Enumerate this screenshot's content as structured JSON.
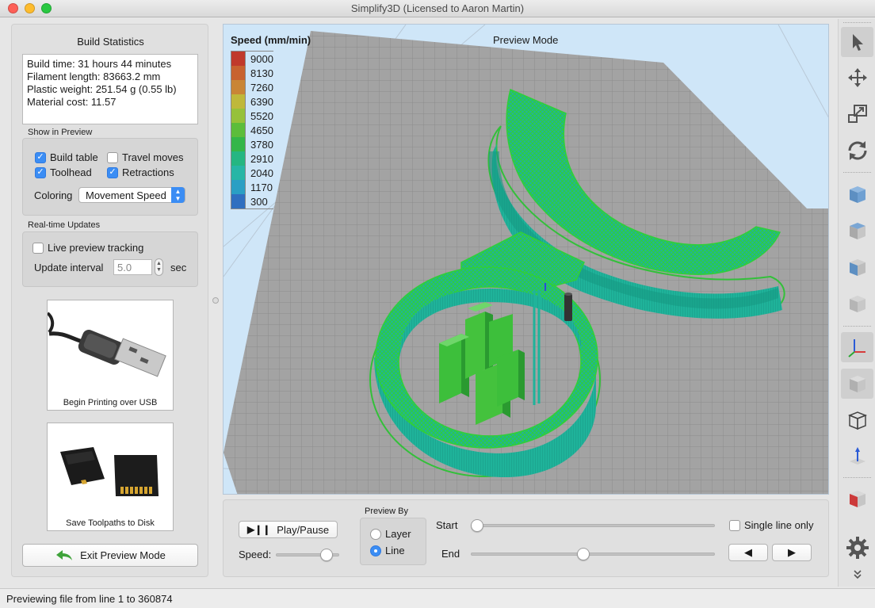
{
  "window": {
    "title": "Simplify3D (Licensed to Aaron Martin)",
    "traffic_lights": [
      "#fd5f57",
      "#febc2e",
      "#29c841"
    ]
  },
  "build_statistics": {
    "title": "Build Statistics",
    "lines": [
      "Build time: 31 hours 44 minutes",
      "Filament length: 83663.2 mm",
      "Plastic weight: 251.54 g (0.55 lb)",
      "Material cost: 11.57"
    ]
  },
  "show_in_preview": {
    "label": "Show in Preview",
    "build_table": {
      "label": "Build table",
      "checked": true
    },
    "travel_moves": {
      "label": "Travel moves",
      "checked": false
    },
    "toolhead": {
      "label": "Toolhead",
      "checked": true
    },
    "retractions": {
      "label": "Retractions",
      "checked": true
    },
    "coloring_label": "Coloring",
    "coloring_value": "Movement Speed"
  },
  "realtime": {
    "label": "Real-time Updates",
    "live_tracking": {
      "label": "Live preview tracking",
      "checked": false
    },
    "interval_label": "Update interval",
    "interval_value": "5.0",
    "interval_unit": "sec"
  },
  "usb_button": {
    "caption": "Begin Printing over USB",
    "icon": "usb-cable-photo"
  },
  "disk_button": {
    "caption": "Save Toolpaths to Disk",
    "icon": "sd-card-photo"
  },
  "exit_button": {
    "label": "Exit Preview Mode",
    "icon": "green-back-arrow-icon"
  },
  "viewport": {
    "mode_title": "Preview Mode",
    "legend_title": "Speed (mm/min)",
    "legend": [
      {
        "value": "9000",
        "color": "#c0392b"
      },
      {
        "value": "8130",
        "color": "#c8622f"
      },
      {
        "value": "7260",
        "color": "#c98535"
      },
      {
        "value": "6390",
        "color": "#bfb83a"
      },
      {
        "value": "5520",
        "color": "#96c13a"
      },
      {
        "value": "4650",
        "color": "#5cbd3b"
      },
      {
        "value": "3780",
        "color": "#34b649"
      },
      {
        "value": "2910",
        "color": "#25b682"
      },
      {
        "value": "2040",
        "color": "#27b6a6"
      },
      {
        "value": "1170",
        "color": "#2a9fc4"
      },
      {
        "value": "300",
        "color": "#2f6fc0"
      }
    ],
    "colors": {
      "background": "#cfe6f8",
      "bed": "#a3a3a3",
      "bed_grid": "#8c8c8c",
      "model": "#1fb39a",
      "model_edge": "#2fcf3a"
    }
  },
  "playback": {
    "play_pause_label": "Play/Pause",
    "speed_label": "Speed:",
    "speed_level": 0.88
  },
  "preview_by": {
    "label": "Preview By",
    "options": [
      {
        "label": "Layer",
        "selected": false
      },
      {
        "label": "Line",
        "selected": true
      }
    ]
  },
  "range": {
    "start_label": "Start",
    "end_label": "End",
    "start_level": 0.0,
    "end_level": 0.46,
    "single_line_label": "Single line only",
    "single_line_checked": false
  },
  "status": {
    "text": "Previewing file from line 1 to 360874"
  },
  "toolbar_icons": [
    "select-arrow-icon",
    "move-icon",
    "scale-icon",
    "rotate-icon",
    "cube-view-icon-1",
    "cube-view-icon-2",
    "cube-view-icon-3",
    "cube-view-icon-4",
    "axes-icon",
    "solid-view-icon",
    "wireframe-icon",
    "build-direction-icon",
    "cross-section-icon",
    "settings-gear-icon",
    "more-chevron-icon"
  ]
}
